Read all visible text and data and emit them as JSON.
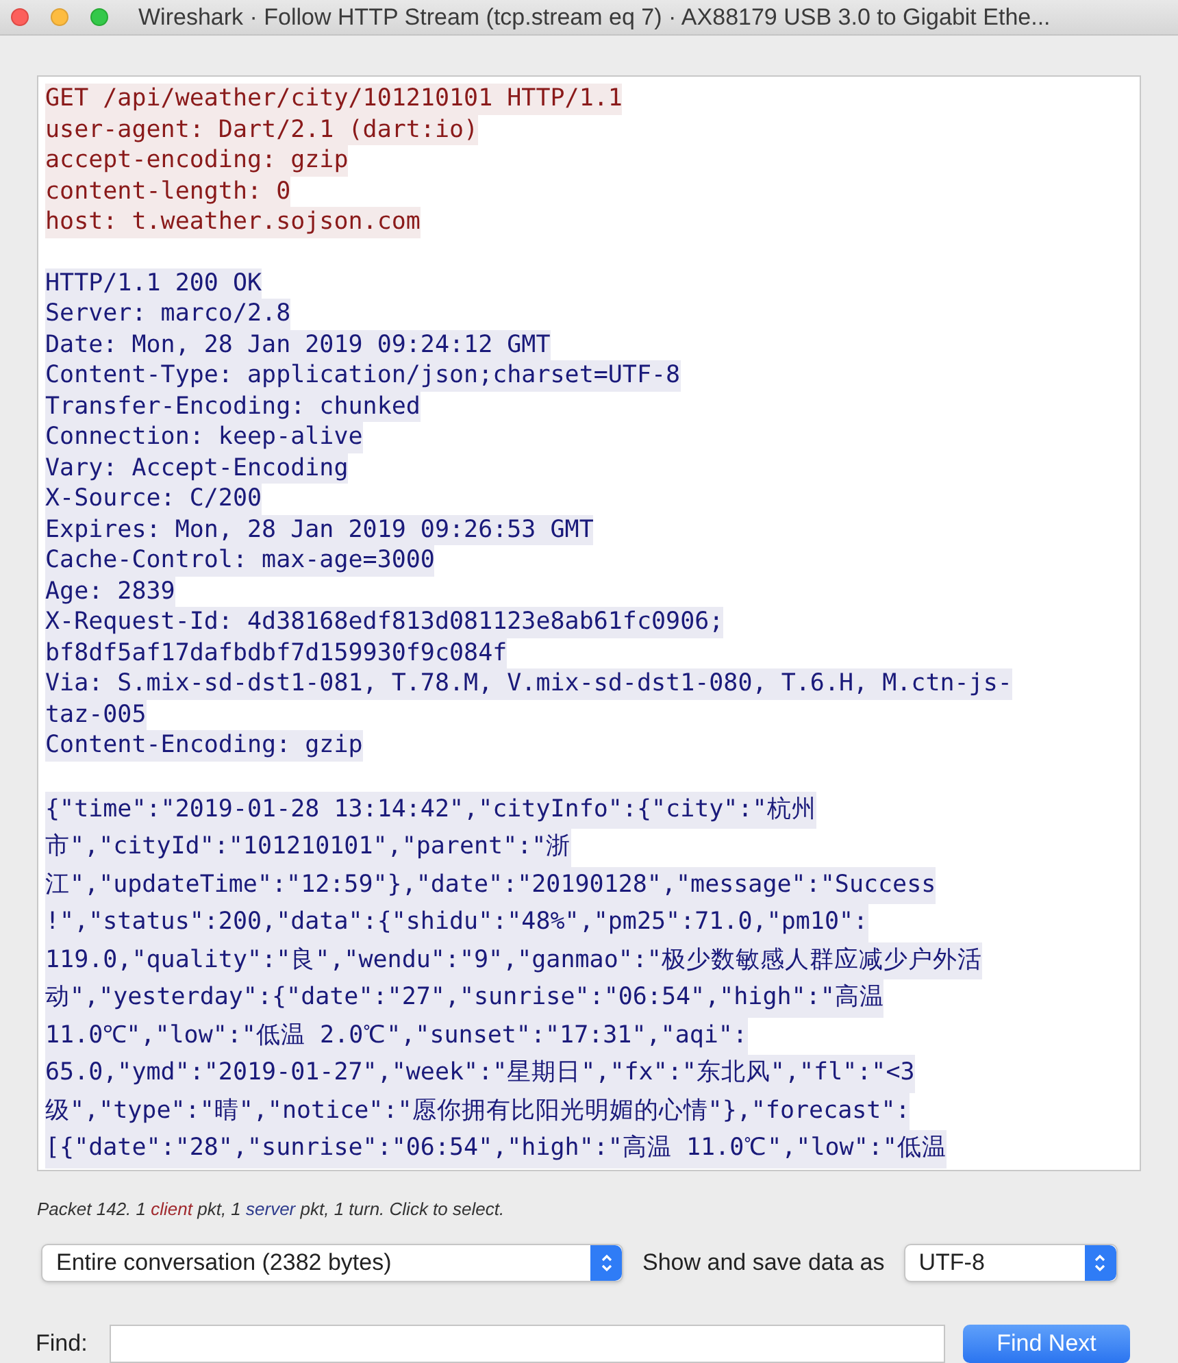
{
  "window": {
    "title": "Wireshark · Follow HTTP Stream (tcp.stream eq 7) · AX88179 USB 3.0 to Gigabit Ethe..."
  },
  "stream": [
    {
      "color": "#8a1a1a",
      "kind": "headers",
      "lines": [
        "GET /api/weather/city/101210101 HTTP/1.1",
        "user-agent: Dart/2.1 (dart:io)",
        "accept-encoding: gzip",
        "content-length: 0",
        "host: t.weather.sojson.com"
      ]
    },
    {
      "color": "#1a1a7a",
      "kind": "headers",
      "lines": [
        "HTTP/1.1 200 OK",
        "Server: marco/2.8",
        "Date: Mon, 28 Jan 2019 09:24:12 GMT",
        "Content-Type: application/json;charset=UTF-8",
        "Transfer-Encoding: chunked",
        "Connection: keep-alive",
        "Vary: Accept-Encoding",
        "X-Source: C/200",
        "Expires: Mon, 28 Jan 2019 09:26:53 GMT",
        "Cache-Control: max-age=3000",
        "Age: 2839",
        "X-Request-Id: 4d38168edf813d081123e8ab61fc0906;",
        "bf8df5af17dafbdbf7d159930f9c084f",
        "Via: S.mix-sd-dst1-081, T.78.M, V.mix-sd-dst1-080, T.6.H, M.ctn-js-",
        "taz-005",
        "Content-Encoding: gzip"
      ]
    },
    {
      "color": "#1a1a7a",
      "kind": "body",
      "lines": [
        "{\"time\":\"2019-01-28 13:14:42\",\"cityInfo\":{\"city\":\"杭州",
        "市\",\"cityId\":\"101210101\",\"parent\":\"浙",
        "江\",\"updateTime\":\"12:59\"},\"date\":\"20190128\",\"message\":\"Success",
        "!\",\"status\":200,\"data\":{\"shidu\":\"48%\",\"pm25\":71.0,\"pm10\":",
        "119.0,\"quality\":\"良\",\"wendu\":\"9\",\"ganmao\":\"极少数敏感人群应减少户外活",
        "动\",\"yesterday\":{\"date\":\"27\",\"sunrise\":\"06:54\",\"high\":\"高温",
        "11.0℃\",\"low\":\"低温 2.0℃\",\"sunset\":\"17:31\",\"aqi\":",
        "65.0,\"ymd\":\"2019-01-27\",\"week\":\"星期日\",\"fx\":\"东北风\",\"fl\":\"<3",
        "级\",\"type\":\"晴\",\"notice\":\"愿你拥有比阳光明媚的心情\"},\"forecast\":",
        "[{\"date\":\"28\",\"sunrise\":\"06:54\",\"high\":\"高温 11.0℃\",\"low\":\"低温"
      ]
    }
  ],
  "summary": [
    {
      "kind": "plain",
      "text": "Packet 142. 1 "
    },
    {
      "kind": "client",
      "text": "client"
    },
    {
      "kind": "plain",
      "text": " pkt, 1 "
    },
    {
      "kind": "server",
      "text": "server"
    },
    {
      "kind": "plain",
      "text": " pkt, 1 turn. Click to select."
    }
  ],
  "conversation_select": {
    "value": "Entire conversation (2382 bytes)"
  },
  "format_label": "Show and save data as",
  "format_select": {
    "value": "UTF-8"
  },
  "find": {
    "label": "Find:",
    "button": "Find Next"
  }
}
